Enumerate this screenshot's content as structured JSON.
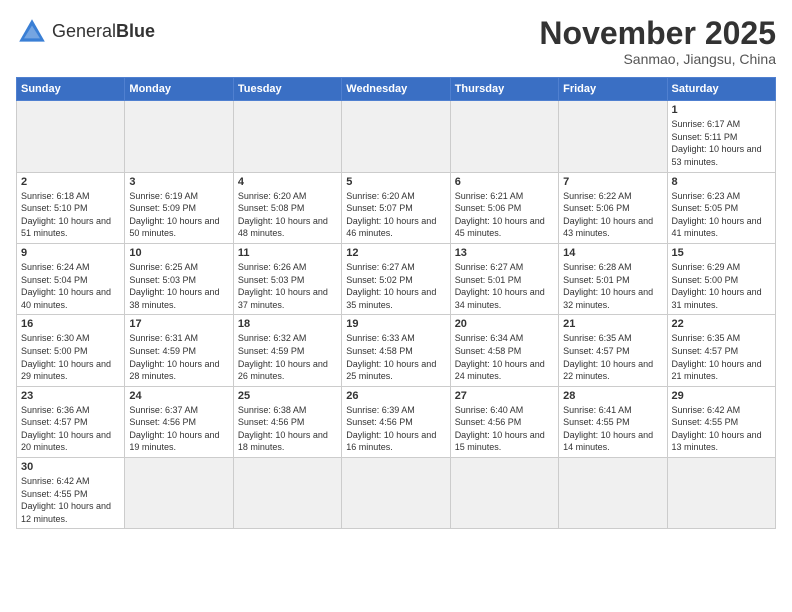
{
  "header": {
    "logo_general": "General",
    "logo_blue": "Blue",
    "month_title": "November 2025",
    "subtitle": "Sanmao, Jiangsu, China"
  },
  "weekdays": [
    "Sunday",
    "Monday",
    "Tuesday",
    "Wednesday",
    "Thursday",
    "Friday",
    "Saturday"
  ],
  "weeks": [
    [
      {
        "day": "",
        "info": "",
        "empty": true
      },
      {
        "day": "",
        "info": "",
        "empty": true
      },
      {
        "day": "",
        "info": "",
        "empty": true
      },
      {
        "day": "",
        "info": "",
        "empty": true
      },
      {
        "day": "",
        "info": "",
        "empty": true
      },
      {
        "day": "",
        "info": "",
        "empty": true
      },
      {
        "day": "1",
        "info": "Sunrise: 6:17 AM\nSunset: 5:11 PM\nDaylight: 10 hours and 53 minutes."
      }
    ],
    [
      {
        "day": "2",
        "info": "Sunrise: 6:18 AM\nSunset: 5:10 PM\nDaylight: 10 hours and 51 minutes."
      },
      {
        "day": "3",
        "info": "Sunrise: 6:19 AM\nSunset: 5:09 PM\nDaylight: 10 hours and 50 minutes."
      },
      {
        "day": "4",
        "info": "Sunrise: 6:20 AM\nSunset: 5:08 PM\nDaylight: 10 hours and 48 minutes."
      },
      {
        "day": "5",
        "info": "Sunrise: 6:20 AM\nSunset: 5:07 PM\nDaylight: 10 hours and 46 minutes."
      },
      {
        "day": "6",
        "info": "Sunrise: 6:21 AM\nSunset: 5:06 PM\nDaylight: 10 hours and 45 minutes."
      },
      {
        "day": "7",
        "info": "Sunrise: 6:22 AM\nSunset: 5:06 PM\nDaylight: 10 hours and 43 minutes."
      },
      {
        "day": "8",
        "info": "Sunrise: 6:23 AM\nSunset: 5:05 PM\nDaylight: 10 hours and 41 minutes."
      }
    ],
    [
      {
        "day": "9",
        "info": "Sunrise: 6:24 AM\nSunset: 5:04 PM\nDaylight: 10 hours and 40 minutes."
      },
      {
        "day": "10",
        "info": "Sunrise: 6:25 AM\nSunset: 5:03 PM\nDaylight: 10 hours and 38 minutes."
      },
      {
        "day": "11",
        "info": "Sunrise: 6:26 AM\nSunset: 5:03 PM\nDaylight: 10 hours and 37 minutes."
      },
      {
        "day": "12",
        "info": "Sunrise: 6:27 AM\nSunset: 5:02 PM\nDaylight: 10 hours and 35 minutes."
      },
      {
        "day": "13",
        "info": "Sunrise: 6:27 AM\nSunset: 5:01 PM\nDaylight: 10 hours and 34 minutes."
      },
      {
        "day": "14",
        "info": "Sunrise: 6:28 AM\nSunset: 5:01 PM\nDaylight: 10 hours and 32 minutes."
      },
      {
        "day": "15",
        "info": "Sunrise: 6:29 AM\nSunset: 5:00 PM\nDaylight: 10 hours and 31 minutes."
      }
    ],
    [
      {
        "day": "16",
        "info": "Sunrise: 6:30 AM\nSunset: 5:00 PM\nDaylight: 10 hours and 29 minutes."
      },
      {
        "day": "17",
        "info": "Sunrise: 6:31 AM\nSunset: 4:59 PM\nDaylight: 10 hours and 28 minutes."
      },
      {
        "day": "18",
        "info": "Sunrise: 6:32 AM\nSunset: 4:59 PM\nDaylight: 10 hours and 26 minutes."
      },
      {
        "day": "19",
        "info": "Sunrise: 6:33 AM\nSunset: 4:58 PM\nDaylight: 10 hours and 25 minutes."
      },
      {
        "day": "20",
        "info": "Sunrise: 6:34 AM\nSunset: 4:58 PM\nDaylight: 10 hours and 24 minutes."
      },
      {
        "day": "21",
        "info": "Sunrise: 6:35 AM\nSunset: 4:57 PM\nDaylight: 10 hours and 22 minutes."
      },
      {
        "day": "22",
        "info": "Sunrise: 6:35 AM\nSunset: 4:57 PM\nDaylight: 10 hours and 21 minutes."
      }
    ],
    [
      {
        "day": "23",
        "info": "Sunrise: 6:36 AM\nSunset: 4:57 PM\nDaylight: 10 hours and 20 minutes."
      },
      {
        "day": "24",
        "info": "Sunrise: 6:37 AM\nSunset: 4:56 PM\nDaylight: 10 hours and 19 minutes."
      },
      {
        "day": "25",
        "info": "Sunrise: 6:38 AM\nSunset: 4:56 PM\nDaylight: 10 hours and 18 minutes."
      },
      {
        "day": "26",
        "info": "Sunrise: 6:39 AM\nSunset: 4:56 PM\nDaylight: 10 hours and 16 minutes."
      },
      {
        "day": "27",
        "info": "Sunrise: 6:40 AM\nSunset: 4:56 PM\nDaylight: 10 hours and 15 minutes."
      },
      {
        "day": "28",
        "info": "Sunrise: 6:41 AM\nSunset: 4:55 PM\nDaylight: 10 hours and 14 minutes."
      },
      {
        "day": "29",
        "info": "Sunrise: 6:42 AM\nSunset: 4:55 PM\nDaylight: 10 hours and 13 minutes."
      }
    ],
    [
      {
        "day": "30",
        "info": "Sunrise: 6:42 AM\nSunset: 4:55 PM\nDaylight: 10 hours and 12 minutes."
      },
      {
        "day": "",
        "info": "",
        "empty": true
      },
      {
        "day": "",
        "info": "",
        "empty": true
      },
      {
        "day": "",
        "info": "",
        "empty": true
      },
      {
        "day": "",
        "info": "",
        "empty": true
      },
      {
        "day": "",
        "info": "",
        "empty": true
      },
      {
        "day": "",
        "info": "",
        "empty": true
      }
    ]
  ]
}
